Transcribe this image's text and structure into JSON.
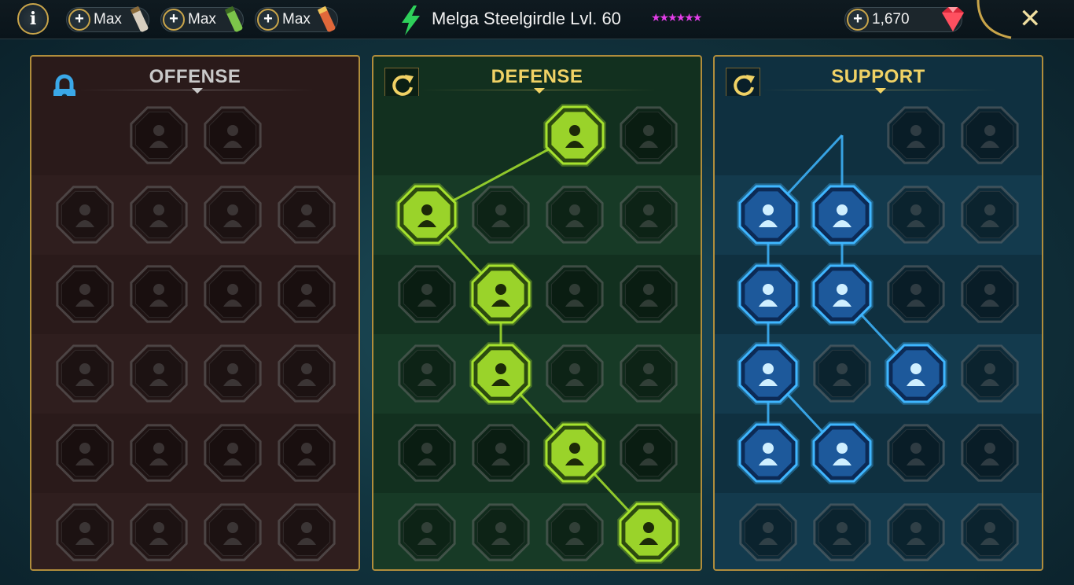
{
  "topbar": {
    "info_label": "i",
    "resources": [
      {
        "name": "scroll-resource",
        "value": "Max",
        "icon": "scroll-icon",
        "color": "#d8cfc0"
      },
      {
        "name": "green-scroll-resource",
        "value": "Max",
        "icon": "green-scroll-icon",
        "color": "#7cc44a"
      },
      {
        "name": "red-scroll-resource",
        "value": "Max",
        "icon": "red-scroll-icon",
        "color": "#e0683a"
      }
    ],
    "hero_name": "Melga Steelgirdle Lvl. 60",
    "stars": "★★★★★★",
    "gems": "1,670",
    "close_label": "✕"
  },
  "panels": [
    {
      "id": "offense",
      "title": "OFFENSE",
      "title_color": "#c9c9c9",
      "locked": true,
      "accent": "#3aa8e8",
      "rows": [
        [
          "",
          "dual-swords-icon",
          "claw-strike-icon",
          ""
        ],
        [
          "horned-demon-icon",
          "slash-icon",
          "shield-sword-icon",
          "bleeding-heart-icon"
        ],
        [
          "chained-arm-icon",
          "fangs-icon",
          "skull-mark-icon",
          "scythe-icon"
        ],
        [
          "sword-heart-icon",
          "fist-blade-icon",
          "axe-icon",
          "chain-bolt-icon"
        ],
        [
          "crossed-daggers-icon",
          "twin-skulls-icon",
          "dagger-ring-icon",
          "warrior-icon"
        ],
        [
          "burning-sword-icon",
          "knight-helm-icon",
          "horned-beast-icon",
          "crested-skull-icon"
        ]
      ],
      "active": [],
      "links": []
    },
    {
      "id": "defense",
      "title": "DEFENSE",
      "title_color": "#f0d265",
      "locked": false,
      "accent": "#a6e22e",
      "rows": [
        [
          "",
          "",
          "bricks-icon",
          "raised-fist-icon"
        ],
        [
          "chevron-shield-icon",
          "heart-stone-icon",
          "ogre-icon",
          "crossed-blades-icon"
        ],
        [
          "parry-icon",
          "knight-shield-icon",
          "heart-skull-icon",
          "hooded-figure-icon"
        ],
        [
          "crowd-icon",
          "hourglass-skull-icon",
          "open-palm-icon",
          "bull-icon"
        ],
        [
          "runner-icon",
          "drops-icon",
          "sun-skull-icon",
          "swirl-icon"
        ],
        [
          "crowned-warrior-icon",
          "layered-shield-icon",
          "bearded-face-icon",
          "flexing-figure-icon"
        ]
      ],
      "active": [
        [
          0,
          2
        ],
        [
          1,
          0
        ],
        [
          2,
          1
        ],
        [
          3,
          1
        ],
        [
          4,
          2
        ],
        [
          5,
          3
        ]
      ],
      "links": [
        [
          [
            0,
            2
          ],
          [
            1,
            0
          ]
        ],
        [
          [
            1,
            0
          ],
          [
            2,
            1
          ]
        ],
        [
          [
            2,
            1
          ],
          [
            3,
            1
          ]
        ],
        [
          [
            3,
            1
          ],
          [
            4,
            2
          ]
        ],
        [
          [
            4,
            2
          ],
          [
            5,
            3
          ]
        ]
      ]
    },
    {
      "id": "support",
      "title": "SUPPORT",
      "title_color": "#f0d265",
      "locked": false,
      "accent": "#3fb6ff",
      "rows": [
        [
          "",
          "",
          "healing-heart-icon",
          "ring-lock-icon"
        ],
        [
          "praying-hands-icon",
          "aura-shield-icon",
          "smoke-skull-icon",
          "speed-lines-icon"
        ],
        [
          "blessed-figure-icon",
          "lightning-shield-icon",
          "cracked-stone-icon",
          "shadow-figure-icon"
        ],
        [
          "chained-heart-icon",
          "comet-icon",
          "open-book-icon",
          "roaring-face-icon"
        ],
        [
          "compass-star-icon",
          "swift-boot-icon",
          "eye-icon",
          "bandit-icon"
        ],
        [
          "potion-skull-icon",
          "horned-skull-icon",
          "stone-fist-icon",
          "eagle-icon"
        ]
      ],
      "active": [
        [
          0,
          1
        ],
        [
          1,
          0
        ],
        [
          1,
          1
        ],
        [
          2,
          0
        ],
        [
          2,
          1
        ],
        [
          3,
          0
        ],
        [
          3,
          2
        ],
        [
          4,
          0
        ],
        [
          4,
          1
        ]
      ],
      "links": [
        [
          [
            0,
            1
          ],
          [
            1,
            0
          ]
        ],
        [
          [
            0,
            1
          ],
          [
            1,
            1
          ]
        ],
        [
          [
            1,
            0
          ],
          [
            2,
            0
          ]
        ],
        [
          [
            1,
            1
          ],
          [
            2,
            1
          ]
        ],
        [
          [
            2,
            0
          ],
          [
            3,
            0
          ]
        ],
        [
          [
            2,
            1
          ],
          [
            3,
            2
          ]
        ],
        [
          [
            3,
            0
          ],
          [
            4,
            0
          ]
        ],
        [
          [
            3,
            0
          ],
          [
            4,
            1
          ]
        ]
      ]
    }
  ]
}
